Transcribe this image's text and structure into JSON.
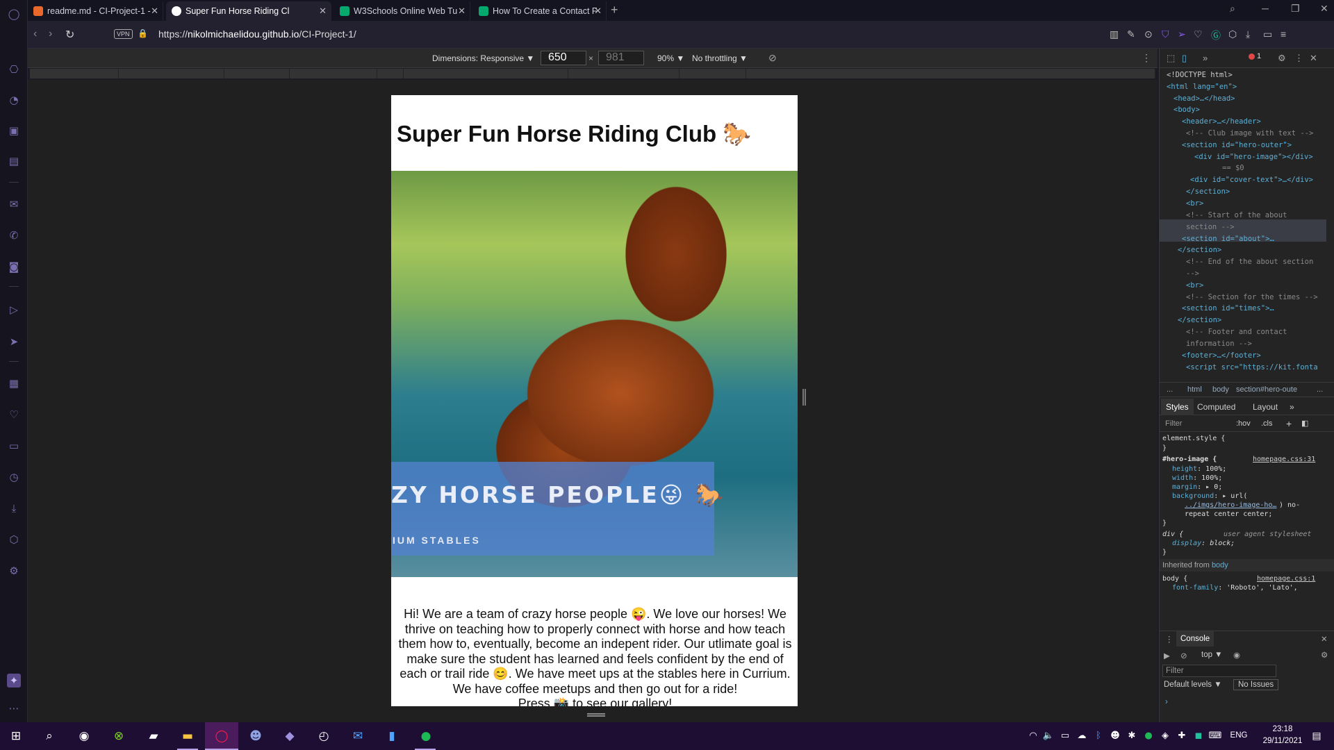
{
  "browser": {
    "tabs": [
      {
        "label": "readme.md - CI-Project-1 -",
        "favicon_color": "#e8692b"
      },
      {
        "label": "Super Fun Horse Riding Cl",
        "favicon_color": "#ffffff"
      },
      {
        "label": "W3Schools Online Web Tu",
        "favicon_color": "#04aa6d"
      },
      {
        "label": "How To Create a Contact F",
        "favicon_color": "#04aa6d"
      }
    ],
    "url_prefix": "https://",
    "url_host": "nikolmichaelidou.github.io",
    "url_path": "/CI-Project-1/",
    "vpn_label": "VPN"
  },
  "device_toolbar": {
    "dimensions_label": "Dimensions: Responsive ▼",
    "width": "650",
    "height": "981",
    "times": "×",
    "zoom": "90% ▼",
    "throttling": "No throttling ▼"
  },
  "page": {
    "title": "Super Fun Horse Riding Club 🐎",
    "hero_heading": "ZY HORSE PEOPLE😜 🐎",
    "hero_subheading": "IUM STABLES",
    "about_text": "Hi! We are a team of crazy horse people 😜. We love our horses! We thrive on teaching how to properly connect with horse and how teach them how to, eventually, become an indepent rider. Our utlimate goal is make sure the student has learned and feels confident by the end of each or trail ride 😊. We have meet ups at the stables here in Currium. We have coffee meetups and then go out for a ride!",
    "gallery_line": "Press 📸 to see our gallery!"
  },
  "devtools": {
    "error_count": "1",
    "dom": [
      "<!DOCTYPE html>",
      "<html lang=\"en\">",
      "<head>…</head>",
      "<body>",
      "<header>…</header>",
      "<!-- Club image with text -->",
      "<section id=\"hero-outer\">",
      "<div id=\"hero-image\"></div>",
      "== $0",
      "<div id=\"cover-text\">…</div>",
      "</section>",
      "<br>",
      "<!-- Start of the about",
      "section -->",
      "<section id=\"about\">…",
      "</section>",
      "<!-- End of the about section",
      "-->",
      "<br>",
      "<!-- Section for the times -->",
      "<section id=\"times\">…",
      "</section>",
      "<!-- Footer and contact",
      "information -->",
      "<footer>…</footer>",
      "<script src=\"https://kit.fonta"
    ],
    "breadcrumb": [
      "...",
      "html",
      "body",
      "section#hero-oute",
      "..."
    ],
    "styles_tabs": [
      "Styles",
      "Computed",
      "Layout",
      "»"
    ],
    "filter_placeholder": "Filter",
    "hov": ":hov",
    "cls": ".cls",
    "rules": {
      "element_style": "element.style {",
      "close": "}",
      "hero_selector": "#hero-image {",
      "hero_source": "homepage.css:31",
      "hero_props": [
        [
          "height",
          "100%;"
        ],
        [
          "width",
          "100%;"
        ],
        [
          "margin",
          "▸ 0;"
        ],
        [
          "background",
          "▸ url("
        ]
      ],
      "hero_url": "../imgs/hero-image-ho…",
      "hero_url_tail": ") no-",
      "hero_repeat": "repeat center center;",
      "div_selector": "div {",
      "div_source": "user agent stylesheet",
      "div_prop": [
        "display",
        "block;"
      ],
      "inherited_label": "Inherited from",
      "inherited_from": "body",
      "body_selector": "body {",
      "body_source": "homepage.css:1",
      "body_prop": [
        "font-family",
        "'Roboto', 'Lato',"
      ]
    },
    "console": {
      "title": "Console",
      "context": "top ▼",
      "filter_placeholder": "Filter",
      "levels": "Default levels ▼",
      "issues": "No Issues",
      "prompt": "›"
    }
  },
  "taskbar": {
    "time": "23:18",
    "date": "29/11/2021",
    "language": "ENG"
  }
}
